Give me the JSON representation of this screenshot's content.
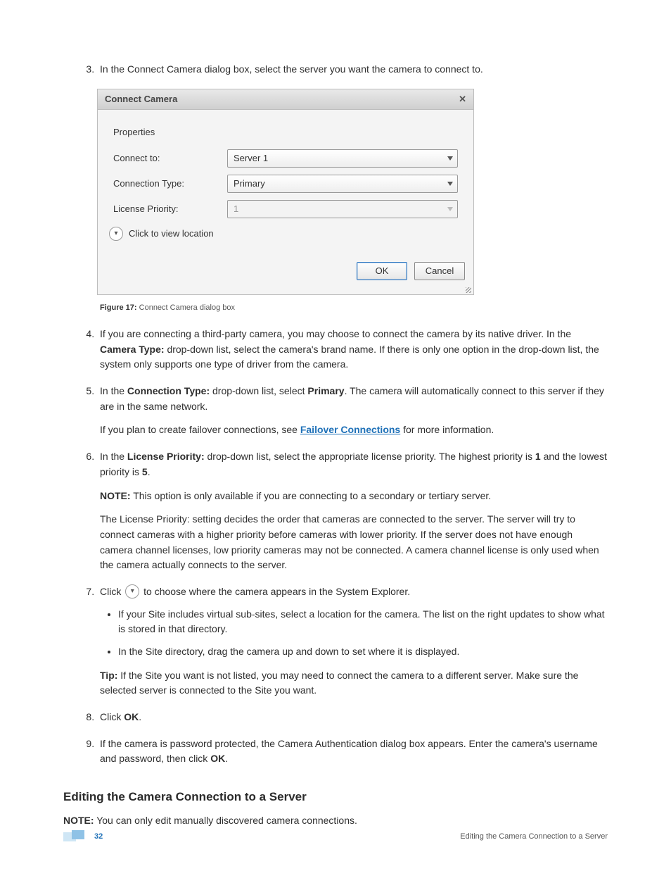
{
  "steps": {
    "s3": "In the Connect Camera dialog box, select the server you want the camera to connect to.",
    "s4_a": "If you are connecting a third-party camera, you may choose to connect the camera by its native driver. In the ",
    "s4_bold": "Camera Type:",
    "s4_b": " drop-down list, select the camera's brand name. If there is only one option in the drop-down list, the system only supports one type of driver from the camera.",
    "s5_a": "In the ",
    "s5_bold1": "Connection Type:",
    "s5_b": " drop-down list, select ",
    "s5_bold2": "Primary",
    "s5_c": ". The camera will automatically connect to this server if they are in the same network.",
    "s5_note_a": "If you plan to create failover connections, see ",
    "s5_link": "Failover Connections",
    "s5_note_b": " for more information.",
    "s6_a": "In the ",
    "s6_bold1": "License Priority:",
    "s6_b": " drop-down list, select the appropriate license priority. The highest priority is ",
    "s6_bold2": "1",
    "s6_c": " and the lowest priority is ",
    "s6_bold3": "5",
    "s6_d": ".",
    "s6_note_label": "NOTE:",
    "s6_note": " This option is only available if you are connecting to a secondary or tertiary server.",
    "s6_para": "The License Priority: setting decides the order that cameras are connected to the server. The server will try to connect cameras with a higher priority before cameras with lower priority. If the server does not have enough camera channel licenses, low priority cameras may not be connected. A camera channel license is only used when the camera actually connects to the server.",
    "s7_a": "Click ",
    "s7_b": " to choose where the camera appears in the System Explorer.",
    "s7_sub1": "If your Site includes virtual sub-sites, select a location for the camera. The list on the right updates to show what is stored in that directory.",
    "s7_sub2": "In the Site directory, drag the camera up and down to set where it is displayed.",
    "s7_tip_label": "Tip:",
    "s7_tip": " If the Site you want is not listed, you may need to connect the camera to a different server. Make sure the selected server is connected to the Site you want.",
    "s8_a": "Click ",
    "s8_bold": "OK",
    "s8_b": ".",
    "s9_a": "If the camera is password protected, the Camera Authentication dialog box appears. Enter the camera's username and password, then click ",
    "s9_bold": "OK",
    "s9_b": "."
  },
  "dialog": {
    "title": "Connect Camera",
    "close": "✕",
    "properties": "Properties",
    "connect_to_label": "Connect to:",
    "connect_to_value": "Server 1",
    "conn_type_label": "Connection Type:",
    "conn_type_value": "Primary",
    "license_label": "License Priority:",
    "license_value": "1",
    "expand": "Click to view location",
    "ok": "OK",
    "cancel": "Cancel"
  },
  "caption": {
    "label": "Figure 17:",
    "text": " Connect Camera dialog box"
  },
  "section_heading": "Editing the Camera Connection to a Server",
  "section_note_label": "NOTE:",
  "section_note": " You can only edit manually discovered camera connections.",
  "footer": {
    "page": "32",
    "title": "Editing the Camera Connection to a Server"
  }
}
